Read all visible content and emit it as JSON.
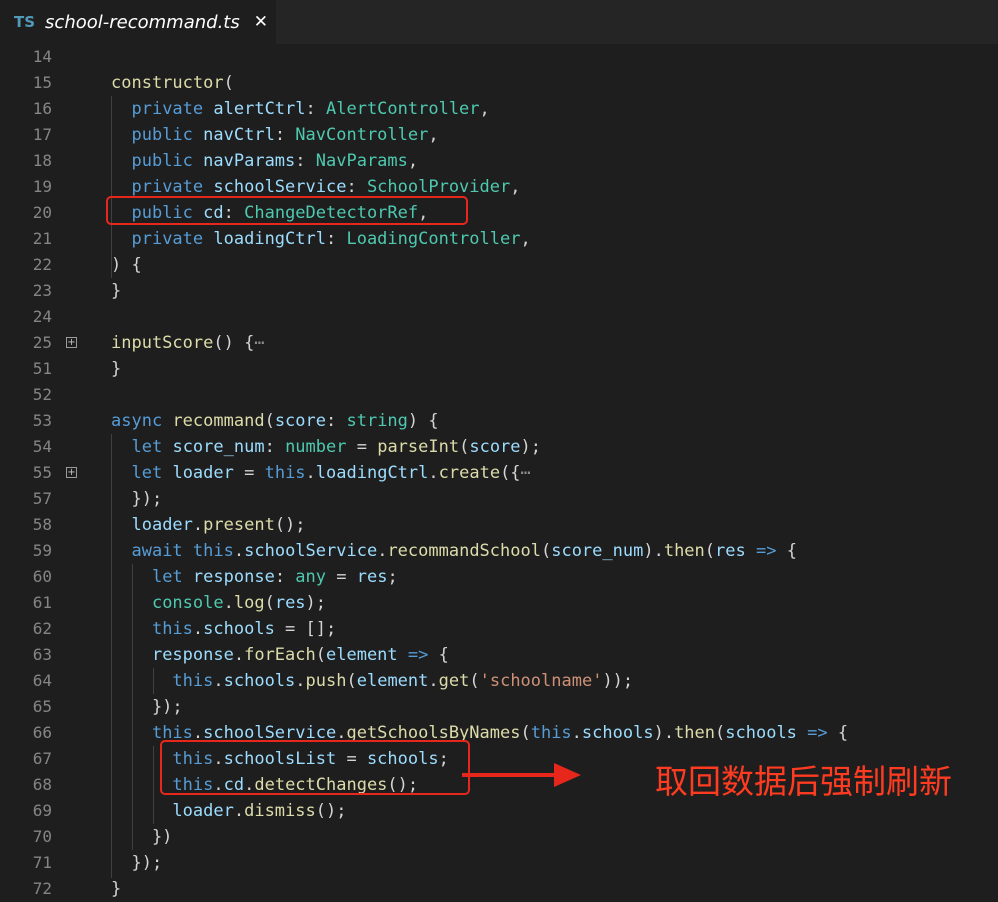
{
  "tab": {
    "badge": "TS",
    "title": "school-recommand.ts",
    "close": "✕"
  },
  "lines": [
    {
      "num": "14",
      "tokens": []
    },
    {
      "num": "15",
      "tokens": [
        [
          "f",
          "constructor"
        ],
        [
          "p",
          "("
        ]
      ]
    },
    {
      "num": "16",
      "tokens": [
        [
          "p",
          "  "
        ],
        [
          "k",
          "private"
        ],
        [
          "p",
          " "
        ],
        [
          "v",
          "alertCtrl"
        ],
        [
          "p",
          ": "
        ],
        [
          "t",
          "AlertController"
        ],
        [
          "p",
          ","
        ]
      ]
    },
    {
      "num": "17",
      "tokens": [
        [
          "p",
          "  "
        ],
        [
          "k",
          "public"
        ],
        [
          "p",
          " "
        ],
        [
          "v",
          "navCtrl"
        ],
        [
          "p",
          ": "
        ],
        [
          "t",
          "NavController"
        ],
        [
          "p",
          ","
        ]
      ]
    },
    {
      "num": "18",
      "tokens": [
        [
          "p",
          "  "
        ],
        [
          "k",
          "public"
        ],
        [
          "p",
          " "
        ],
        [
          "v",
          "navParams"
        ],
        [
          "p",
          ": "
        ],
        [
          "t",
          "NavParams"
        ],
        [
          "p",
          ","
        ]
      ]
    },
    {
      "num": "19",
      "tokens": [
        [
          "p",
          "  "
        ],
        [
          "k",
          "private"
        ],
        [
          "p",
          " "
        ],
        [
          "v",
          "schoolService"
        ],
        [
          "p",
          ": "
        ],
        [
          "t",
          "SchoolProvider"
        ],
        [
          "p",
          ","
        ]
      ]
    },
    {
      "num": "20",
      "tokens": [
        [
          "p",
          "  "
        ],
        [
          "k",
          "public"
        ],
        [
          "p",
          " "
        ],
        [
          "v",
          "cd"
        ],
        [
          "p",
          ": "
        ],
        [
          "t",
          "ChangeDetectorRef"
        ],
        [
          "p",
          ","
        ]
      ]
    },
    {
      "num": "21",
      "tokens": [
        [
          "p",
          "  "
        ],
        [
          "k",
          "private"
        ],
        [
          "p",
          " "
        ],
        [
          "v",
          "loadingCtrl"
        ],
        [
          "p",
          ": "
        ],
        [
          "t",
          "LoadingController"
        ],
        [
          "p",
          ","
        ]
      ]
    },
    {
      "num": "22",
      "tokens": [
        [
          "p",
          ") {"
        ]
      ]
    },
    {
      "num": "23",
      "tokens": [
        [
          "p",
          "}"
        ]
      ]
    },
    {
      "num": "24",
      "tokens": []
    },
    {
      "num": "25",
      "fold": true,
      "tokens": [
        [
          "f",
          "inputScore"
        ],
        [
          "p",
          "() {"
        ],
        [
          "ell",
          "⋯"
        ]
      ]
    },
    {
      "num": "51",
      "tokens": [
        [
          "p",
          "}"
        ]
      ]
    },
    {
      "num": "52",
      "tokens": []
    },
    {
      "num": "53",
      "tokens": [
        [
          "k",
          "async"
        ],
        [
          "p",
          " "
        ],
        [
          "f",
          "recommand"
        ],
        [
          "p",
          "("
        ],
        [
          "v",
          "score"
        ],
        [
          "p",
          ": "
        ],
        [
          "t",
          "string"
        ],
        [
          "p",
          ") {"
        ]
      ]
    },
    {
      "num": "54",
      "tokens": [
        [
          "p",
          "  "
        ],
        [
          "k",
          "let"
        ],
        [
          "p",
          " "
        ],
        [
          "v",
          "score_num"
        ],
        [
          "p",
          ": "
        ],
        [
          "t",
          "number"
        ],
        [
          "p",
          " = "
        ],
        [
          "f",
          "parseInt"
        ],
        [
          "p",
          "("
        ],
        [
          "v",
          "score"
        ],
        [
          "p",
          ");"
        ]
      ]
    },
    {
      "num": "55",
      "fold": true,
      "tokens": [
        [
          "p",
          "  "
        ],
        [
          "k",
          "let"
        ],
        [
          "p",
          " "
        ],
        [
          "v",
          "loader"
        ],
        [
          "p",
          " = "
        ],
        [
          "k",
          "this"
        ],
        [
          "p",
          "."
        ],
        [
          "v",
          "loadingCtrl"
        ],
        [
          "p",
          "."
        ],
        [
          "f",
          "create"
        ],
        [
          "p",
          "({"
        ],
        [
          "ell",
          "⋯"
        ]
      ]
    },
    {
      "num": "57",
      "tokens": [
        [
          "p",
          "  });"
        ]
      ]
    },
    {
      "num": "58",
      "tokens": [
        [
          "p",
          "  "
        ],
        [
          "v",
          "loader"
        ],
        [
          "p",
          "."
        ],
        [
          "f",
          "present"
        ],
        [
          "p",
          "();"
        ]
      ]
    },
    {
      "num": "59",
      "tokens": [
        [
          "p",
          "  "
        ],
        [
          "k",
          "await"
        ],
        [
          "p",
          " "
        ],
        [
          "k",
          "this"
        ],
        [
          "p",
          "."
        ],
        [
          "v",
          "schoolService"
        ],
        [
          "p",
          "."
        ],
        [
          "f",
          "recommandSchool"
        ],
        [
          "p",
          "("
        ],
        [
          "v",
          "score_num"
        ],
        [
          "p",
          ")."
        ],
        [
          "f",
          "then"
        ],
        [
          "p",
          "("
        ],
        [
          "v",
          "res"
        ],
        [
          "p",
          " "
        ],
        [
          "k",
          "=>"
        ],
        [
          "p",
          " {"
        ]
      ]
    },
    {
      "num": "60",
      "tokens": [
        [
          "p",
          "    "
        ],
        [
          "k",
          "let"
        ],
        [
          "p",
          " "
        ],
        [
          "v",
          "response"
        ],
        [
          "p",
          ": "
        ],
        [
          "t",
          "any"
        ],
        [
          "p",
          " = "
        ],
        [
          "v",
          "res"
        ],
        [
          "p",
          ";"
        ]
      ]
    },
    {
      "num": "61",
      "tokens": [
        [
          "p",
          "    "
        ],
        [
          "t",
          "console"
        ],
        [
          "p",
          "."
        ],
        [
          "f",
          "log"
        ],
        [
          "p",
          "("
        ],
        [
          "v",
          "res"
        ],
        [
          "p",
          ");"
        ]
      ]
    },
    {
      "num": "62",
      "tokens": [
        [
          "p",
          "    "
        ],
        [
          "k",
          "this"
        ],
        [
          "p",
          "."
        ],
        [
          "v",
          "schools"
        ],
        [
          "p",
          " = [];"
        ]
      ]
    },
    {
      "num": "63",
      "tokens": [
        [
          "p",
          "    "
        ],
        [
          "v",
          "response"
        ],
        [
          "p",
          "."
        ],
        [
          "f",
          "forEach"
        ],
        [
          "p",
          "("
        ],
        [
          "v",
          "element"
        ],
        [
          "p",
          " "
        ],
        [
          "k",
          "=>"
        ],
        [
          "p",
          " {"
        ]
      ]
    },
    {
      "num": "64",
      "tokens": [
        [
          "p",
          "      "
        ],
        [
          "k",
          "this"
        ],
        [
          "p",
          "."
        ],
        [
          "v",
          "schools"
        ],
        [
          "p",
          "."
        ],
        [
          "f",
          "push"
        ],
        [
          "p",
          "("
        ],
        [
          "v",
          "element"
        ],
        [
          "p",
          "."
        ],
        [
          "f",
          "get"
        ],
        [
          "p",
          "("
        ],
        [
          "s",
          "'schoolname'"
        ],
        [
          "p",
          "));"
        ]
      ]
    },
    {
      "num": "65",
      "tokens": [
        [
          "p",
          "    });"
        ]
      ]
    },
    {
      "num": "66",
      "tokens": [
        [
          "p",
          "    "
        ],
        [
          "k",
          "this"
        ],
        [
          "p",
          "."
        ],
        [
          "v",
          "schoolService"
        ],
        [
          "p",
          "."
        ],
        [
          "f",
          "getSchoolsByNames"
        ],
        [
          "p",
          "("
        ],
        [
          "k",
          "this"
        ],
        [
          "p",
          "."
        ],
        [
          "v",
          "schools"
        ],
        [
          "p",
          ")."
        ],
        [
          "f",
          "then"
        ],
        [
          "p",
          "("
        ],
        [
          "v",
          "schools"
        ],
        [
          "p",
          " "
        ],
        [
          "k",
          "=>"
        ],
        [
          "p",
          " {"
        ]
      ]
    },
    {
      "num": "67",
      "tokens": [
        [
          "p",
          "      "
        ],
        [
          "k",
          "this"
        ],
        [
          "p",
          "."
        ],
        [
          "v",
          "schoolsList"
        ],
        [
          "p",
          " = "
        ],
        [
          "v",
          "schools"
        ],
        [
          "p",
          ";"
        ]
      ]
    },
    {
      "num": "68",
      "tokens": [
        [
          "p",
          "      "
        ],
        [
          "k",
          "this"
        ],
        [
          "p",
          "."
        ],
        [
          "v",
          "cd"
        ],
        [
          "p",
          "."
        ],
        [
          "f",
          "detectChanges"
        ],
        [
          "p",
          "();"
        ]
      ]
    },
    {
      "num": "69",
      "tokens": [
        [
          "p",
          "      "
        ],
        [
          "v",
          "loader"
        ],
        [
          "p",
          "."
        ],
        [
          "f",
          "dismiss"
        ],
        [
          "p",
          "();"
        ]
      ]
    },
    {
      "num": "70",
      "tokens": [
        [
          "p",
          "    })"
        ]
      ]
    },
    {
      "num": "71",
      "tokens": [
        [
          "p",
          "  });"
        ]
      ]
    },
    {
      "num": "72",
      "tokens": [
        [
          "p",
          "}"
        ]
      ]
    }
  ],
  "annotation": {
    "text": "取回数据后强制刷新",
    "color": "#ff3b21"
  },
  "colors": {
    "keyword": "#569cd6",
    "type": "#4ec9b0",
    "function": "#dcdcaa",
    "variable": "#9cdcfe",
    "punctuation": "#d4d4d4",
    "string": "#ce9178",
    "highlight_box": "#e8271c"
  }
}
